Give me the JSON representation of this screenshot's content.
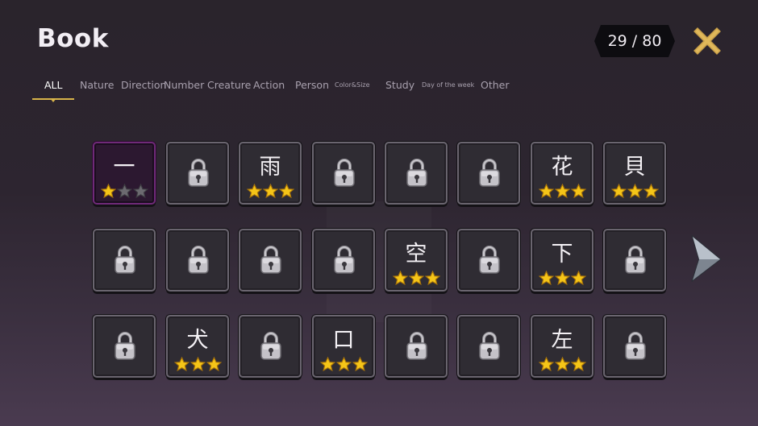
{
  "header": {
    "title": "Book",
    "progress_text": "29 / 80"
  },
  "tabs": [
    {
      "label": "ALL",
      "active": true
    },
    {
      "label": "Nature"
    },
    {
      "label": "Direction"
    },
    {
      "label": "Number"
    },
    {
      "label": "Creature"
    },
    {
      "label": "Action"
    },
    {
      "label": "Person"
    },
    {
      "label": "Color&Size",
      "small": true
    },
    {
      "label": "Study"
    },
    {
      "label": "Day of the week",
      "small": true
    },
    {
      "label": "Other"
    }
  ],
  "colors": {
    "star_gold": "#f5c518",
    "star_empty": "#6c6a70",
    "accent_gold": "#d8b44a",
    "selected_border": "#6f2a78"
  },
  "cards": [
    {
      "kanji": "一",
      "stars": 1,
      "selected": true
    },
    {
      "locked": true
    },
    {
      "kanji": "雨",
      "stars": 3
    },
    {
      "locked": true
    },
    {
      "locked": true
    },
    {
      "locked": true
    },
    {
      "kanji": "花",
      "stars": 3
    },
    {
      "kanji": "貝",
      "stars": 3
    },
    {
      "locked": true
    },
    {
      "locked": true
    },
    {
      "locked": true
    },
    {
      "locked": true
    },
    {
      "kanji": "空",
      "stars": 3
    },
    {
      "locked": true
    },
    {
      "kanji": "下",
      "stars": 3
    },
    {
      "locked": true
    },
    {
      "locked": true
    },
    {
      "kanji": "犬",
      "stars": 3
    },
    {
      "locked": true
    },
    {
      "kanji": "口",
      "stars": 3
    },
    {
      "locked": true
    },
    {
      "locked": true
    },
    {
      "kanji": "左",
      "stars": 3
    },
    {
      "locked": true
    }
  ]
}
